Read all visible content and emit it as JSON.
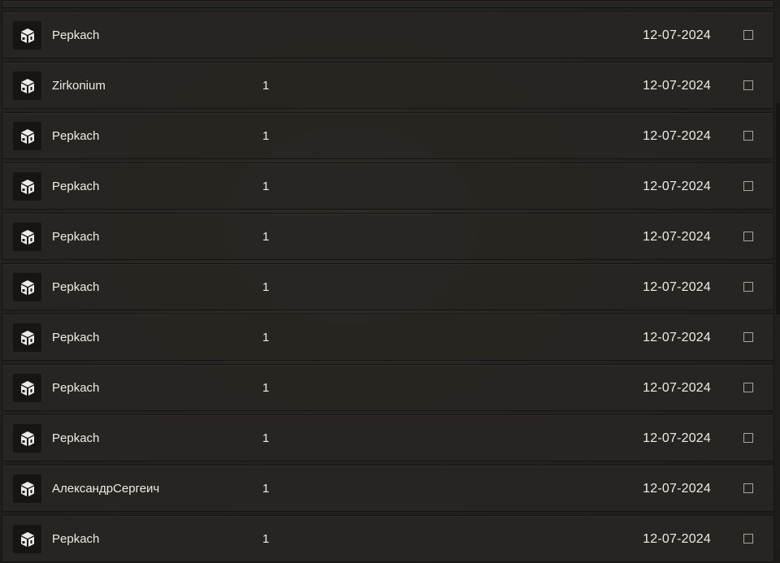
{
  "rows": [
    {
      "name": "Pepkach",
      "qty": "",
      "date": "12-07-2024"
    },
    {
      "name": "Zirkonium",
      "qty": "1",
      "date": "12-07-2024"
    },
    {
      "name": "Pepkach",
      "qty": "1",
      "date": "12-07-2024"
    },
    {
      "name": "Pepkach",
      "qty": "1",
      "date": "12-07-2024"
    },
    {
      "name": "Pepkach",
      "qty": "1",
      "date": "12-07-2024"
    },
    {
      "name": "Pepkach",
      "qty": "1",
      "date": "12-07-2024"
    },
    {
      "name": "Pepkach",
      "qty": "1",
      "date": "12-07-2024"
    },
    {
      "name": "Pepkach",
      "qty": "1",
      "date": "12-07-2024"
    },
    {
      "name": "Pepkach",
      "qty": "1",
      "date": "12-07-2024"
    },
    {
      "name": "АлександрСергеич",
      "qty": "1",
      "date": "12-07-2024"
    },
    {
      "name": "Pepkach",
      "qty": "1",
      "date": "12-07-2024"
    }
  ],
  "row_icon": "package-box-icon"
}
